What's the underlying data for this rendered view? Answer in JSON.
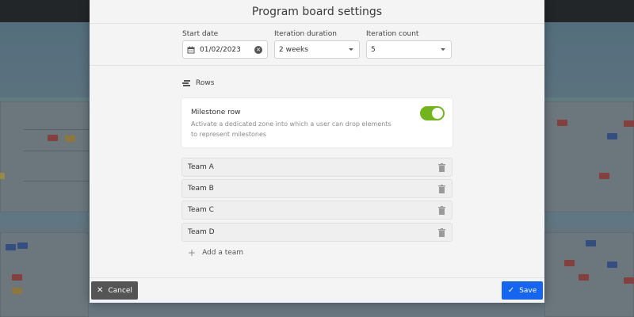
{
  "modal": {
    "title": "Program board settings"
  },
  "settings": {
    "start_date": {
      "label": "Start date",
      "value": "01/02/2023"
    },
    "iteration_duration": {
      "label": "Iteration duration",
      "value": "2 weeks"
    },
    "iteration_count": {
      "label": "Iteration count",
      "value": "5"
    }
  },
  "rows": {
    "heading": "Rows",
    "milestone": {
      "title": "Milestone row",
      "description": "Activate a dedicated zone into which a user can drop elements to represent milestones",
      "enabled": true
    },
    "teams": [
      {
        "label": "Team A"
      },
      {
        "label": "Team B"
      },
      {
        "label": "Team C"
      },
      {
        "label": "Team D"
      }
    ],
    "add_team_label": "Add a team"
  },
  "footer": {
    "cancel_label": "Cancel",
    "save_label": "Save"
  },
  "colors": {
    "accent": "#1565f0",
    "toggle_on": "#72b41c",
    "cancel": "#555555"
  },
  "icons": [
    "calendar-icon",
    "clear-icon",
    "chevron-down-icon",
    "rows-icon",
    "trash-icon",
    "plus-icon",
    "close-icon",
    "check-icon"
  ]
}
